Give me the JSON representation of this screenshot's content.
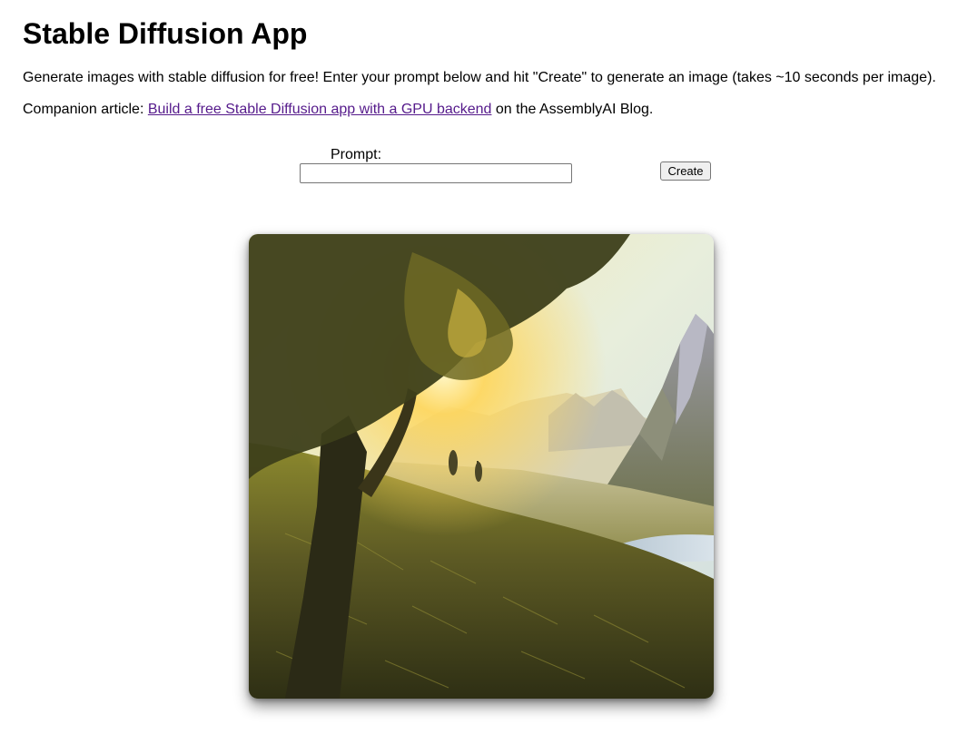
{
  "header": {
    "title": "Stable Diffusion App"
  },
  "intro": {
    "text": "Generate images with stable diffusion for free! Enter your prompt below and hit \"Create\" to generate an image (takes ~10 seconds per image)."
  },
  "companion": {
    "prefix": "Companion article: ",
    "link_text": "Build a free Stable Diffusion app with a GPU backend",
    "suffix": " on the AssemblyAI Blog."
  },
  "form": {
    "prompt_label": "Prompt:",
    "prompt_value": "",
    "create_label": "Create"
  },
  "colors": {
    "link_visited": "#551a8b"
  }
}
